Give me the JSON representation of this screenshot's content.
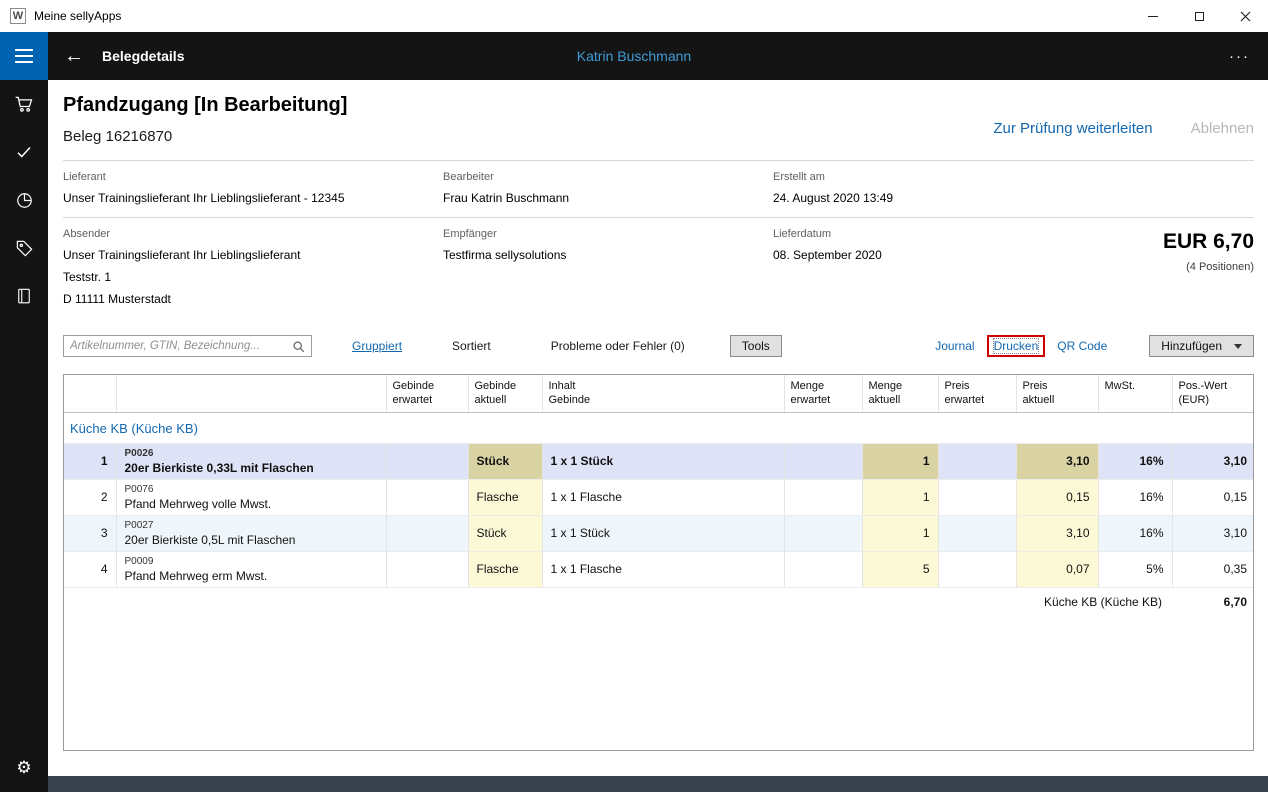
{
  "window": {
    "title": "Meine sellyApps",
    "app_icon_glyph": "W",
    "controls": [
      "minimize",
      "maximize",
      "close"
    ]
  },
  "header": {
    "back_icon": "arrow-left",
    "title": "Belegdetails",
    "user": "Katrin Buschmann",
    "more": "···"
  },
  "sidebar": {
    "icons": [
      "hamburger-menu",
      "cart",
      "checkmark",
      "pie-chart",
      "price-tag",
      "book"
    ],
    "settings_icon": "gear",
    "settings_glyph": "⚙"
  },
  "document": {
    "title": "Pfandzugang [In Bearbeitung]",
    "beleg": "Beleg 16216870",
    "actions": {
      "forward": "Zur Prüfung weiterleiten",
      "reject": "Ablehnen"
    },
    "info": [
      {
        "label": "Lieferant",
        "value": "Unser Trainingslieferant Ihr Lieblingslieferant - 12345"
      },
      {
        "label": "Bearbeiter",
        "value": "Frau Katrin Buschmann"
      },
      {
        "label": "Erstellt am",
        "value": "24. August 2020 13:49"
      }
    ],
    "absender": {
      "label": "Absender",
      "lines": [
        "Unser Trainingslieferant Ihr Lieblingslieferant",
        "Teststr. 1",
        "D 11111 Musterstadt"
      ]
    },
    "empfaenger": {
      "label": "Empfänger",
      "value": "Testfirma sellysolutions"
    },
    "lieferdatum": {
      "label": "Lieferdatum",
      "value": "08. September 2020"
    },
    "total": {
      "amount": "EUR 6,70",
      "positions": "(4 Positionen)"
    }
  },
  "toolbar": {
    "search_placeholder": "Artikelnummer, GTIN, Bezeichnung...",
    "search_icon": "magnifier",
    "gruppiert": "Gruppiert",
    "sortiert": "Sortiert",
    "probleme": "Probleme oder Fehler (0)",
    "tools": "Tools",
    "journal": "Journal",
    "drucken": "Drucken",
    "qr_code": "QR Code",
    "hinzufuegen": "Hinzufügen",
    "hinzufuegen_icon": "chevron-down"
  },
  "table": {
    "headers": [
      "",
      "",
      "Gebinde\nerwartet",
      "Gebinde\naktuell",
      "Inhalt\nGebinde",
      "Menge\nerwartet",
      "Menge\naktuell",
      "Preis\nerwartet",
      "Preis\naktuell",
      "MwSt.",
      "Pos.-Wert\n(EUR)"
    ],
    "group": "Küche KB (Küche KB)",
    "rows": [
      {
        "nr": "1",
        "code": "P0026",
        "name": "20er Bierkiste 0,33L mit Flaschen",
        "gebinde_aktuell": "Stück",
        "inhalt": "1 x 1 Stück",
        "menge_aktuell": "1",
        "preis_aktuell": "3,10",
        "mwst": "16%",
        "pos_wert": "3,10"
      },
      {
        "nr": "2",
        "code": "P0076",
        "name": "Pfand Mehrweg volle Mwst.",
        "gebinde_aktuell": "Flasche",
        "inhalt": "1 x 1 Flasche",
        "menge_aktuell": "1",
        "preis_aktuell": "0,15",
        "mwst": "16%",
        "pos_wert": "0,15"
      },
      {
        "nr": "3",
        "code": "P0027",
        "name": "20er Bierkiste 0,5L mit Flaschen",
        "gebinde_aktuell": "Stück",
        "inhalt": "1 x 1 Stück",
        "menge_aktuell": "1",
        "preis_aktuell": "3,10",
        "mwst": "16%",
        "pos_wert": "3,10"
      },
      {
        "nr": "4",
        "code": "P0009",
        "name": "Pfand Mehrweg erm Mwst.",
        "gebinde_aktuell": "Flasche",
        "inhalt": "1 x 1 Flasche",
        "menge_aktuell": "5",
        "preis_aktuell": "0,07",
        "mwst": "5%",
        "pos_wert": "0,35"
      }
    ],
    "footer": {
      "label": "Küche KB (Küche KB)",
      "total": "6,70"
    }
  },
  "colors": {
    "accent": "#0063B1",
    "link": "#1268B1",
    "header_user": "#3E9BD6",
    "selected_row": "#DFE3F7",
    "selected_highlight": "#D9D2A3",
    "cell_highlight": "#FCF9D7",
    "alt_row": "#EFF6FB",
    "annotation": "#CC0000",
    "bottom_bar": "#39424D"
  }
}
